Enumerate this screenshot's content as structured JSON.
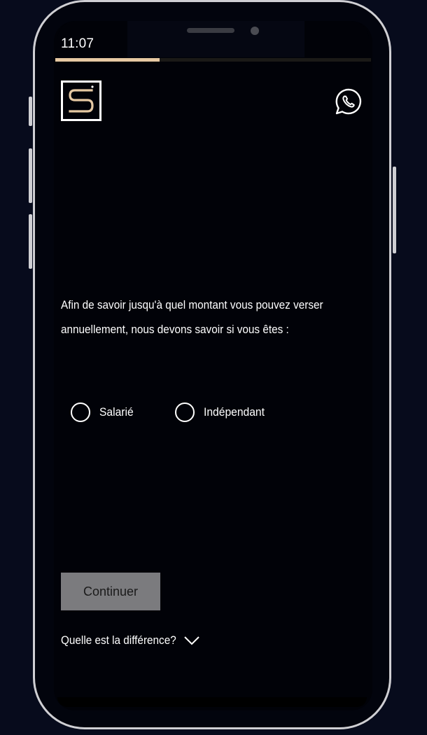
{
  "status_bar": {
    "time": "11:07"
  },
  "progress": {
    "fraction": 0.33,
    "fill_color": "#e6c9a3"
  },
  "header": {
    "logo_icon": "s-logo-icon",
    "contact_icon": "whatsapp-icon"
  },
  "question": {
    "text": "Afin de savoir jusqu'à quel montant vous pouvez verser annuellement, nous devons savoir si vous êtes :"
  },
  "options": [
    {
      "label": "Salarié",
      "selected": false
    },
    {
      "label": "Indépendant",
      "selected": false
    }
  ],
  "actions": {
    "continue_label": "Continuer",
    "difference_label": "Quelle est la différence?"
  },
  "colors": {
    "accent": "#e6c9a3",
    "button_disabled": "#7b7b7e",
    "background": "#010208"
  }
}
